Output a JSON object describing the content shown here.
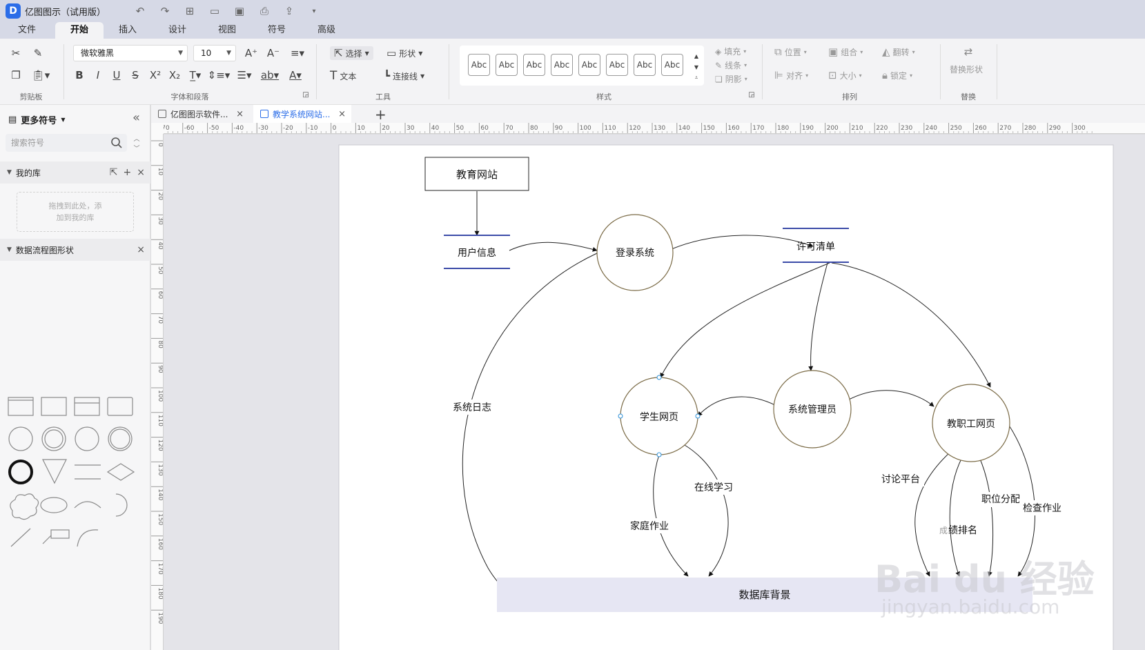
{
  "app": {
    "logo_glyph": "D",
    "title": "亿图图示（试用版）"
  },
  "menu": {
    "tabs": [
      {
        "label": "文件"
      },
      {
        "label": "开始"
      },
      {
        "label": "插入"
      },
      {
        "label": "设计"
      },
      {
        "label": "视图"
      },
      {
        "label": "符号"
      },
      {
        "label": "高级"
      }
    ],
    "active": "开始"
  },
  "ribbon": {
    "font_family": "微软雅黑",
    "font_size": "10",
    "select_label": "选择",
    "shape_label": "形状",
    "text_label": "文本",
    "connector_label": "连接线",
    "style_swatch": "Abc",
    "fill_label": "填充",
    "line_label": "线条",
    "shadow_label": "阴影",
    "position_label": "位置",
    "group_label": "组合",
    "flip_label": "翻转",
    "align_label": "对齐",
    "size_label": "大小",
    "lock_label": "锁定",
    "replace_shape_label": "替换形状",
    "groups": {
      "clipboard": "剪贴板",
      "font_para": "字体和段落",
      "tools": "工具",
      "styles": "样式",
      "arrange": "排列",
      "replace": "替换"
    }
  },
  "left_panel": {
    "title": "更多符号",
    "search_placeholder": "搜索符号",
    "my_library": "我的库",
    "drop_hint_line1": "拖拽到此处，添",
    "drop_hint_line2": "加到我的库",
    "dfd_library": "数据流程图形状"
  },
  "doc_tabs": [
    {
      "label": "亿图图示软件..."
    },
    {
      "label": "教学系统网站..."
    }
  ],
  "ruler": {
    "h_ticks": [
      "-70",
      "-60",
      "-50",
      "-40",
      "-30",
      "-20",
      "-10",
      "0",
      "10",
      "20",
      "30",
      "40",
      "50",
      "60",
      "70",
      "80",
      "90",
      "100",
      "110",
      "120",
      "130",
      "140",
      "150",
      "160",
      "170",
      "180",
      "190",
      "200",
      "210",
      "220",
      "230",
      "240",
      "250",
      "260",
      "270",
      "280",
      "290",
      "300"
    ],
    "v_ticks": [
      "0",
      "10",
      "20",
      "30",
      "40",
      "50",
      "60",
      "70",
      "80",
      "90",
      "100",
      "110",
      "120",
      "130",
      "140",
      "150",
      "160",
      "170",
      "180",
      "190"
    ]
  },
  "diagram": {
    "entity": "教育网站",
    "store_user": "用户信息",
    "process_login": "登录系统",
    "store_permission": "许可清单",
    "process_student": "学生网页",
    "process_admin": "系统管理员",
    "process_staff": "教职工网页",
    "flow_log": "系统日志",
    "flow_online": "在线学习",
    "flow_homework": "家庭作业",
    "flow_forum": "讨论平台",
    "flow_position": "职位分配",
    "flow_check": "检查作业",
    "flow_rank_a": "成",
    "flow_rank_b": "绩排名",
    "database": "数据库背景"
  },
  "watermark": {
    "main": "Bai du 经验",
    "sub": "jingyan.baidu.com"
  },
  "colors": {
    "accent": "#2b6de8",
    "store_line": "#3b4ba8",
    "circle": "#7a6a45",
    "database_fill": "#e6e6f3"
  }
}
